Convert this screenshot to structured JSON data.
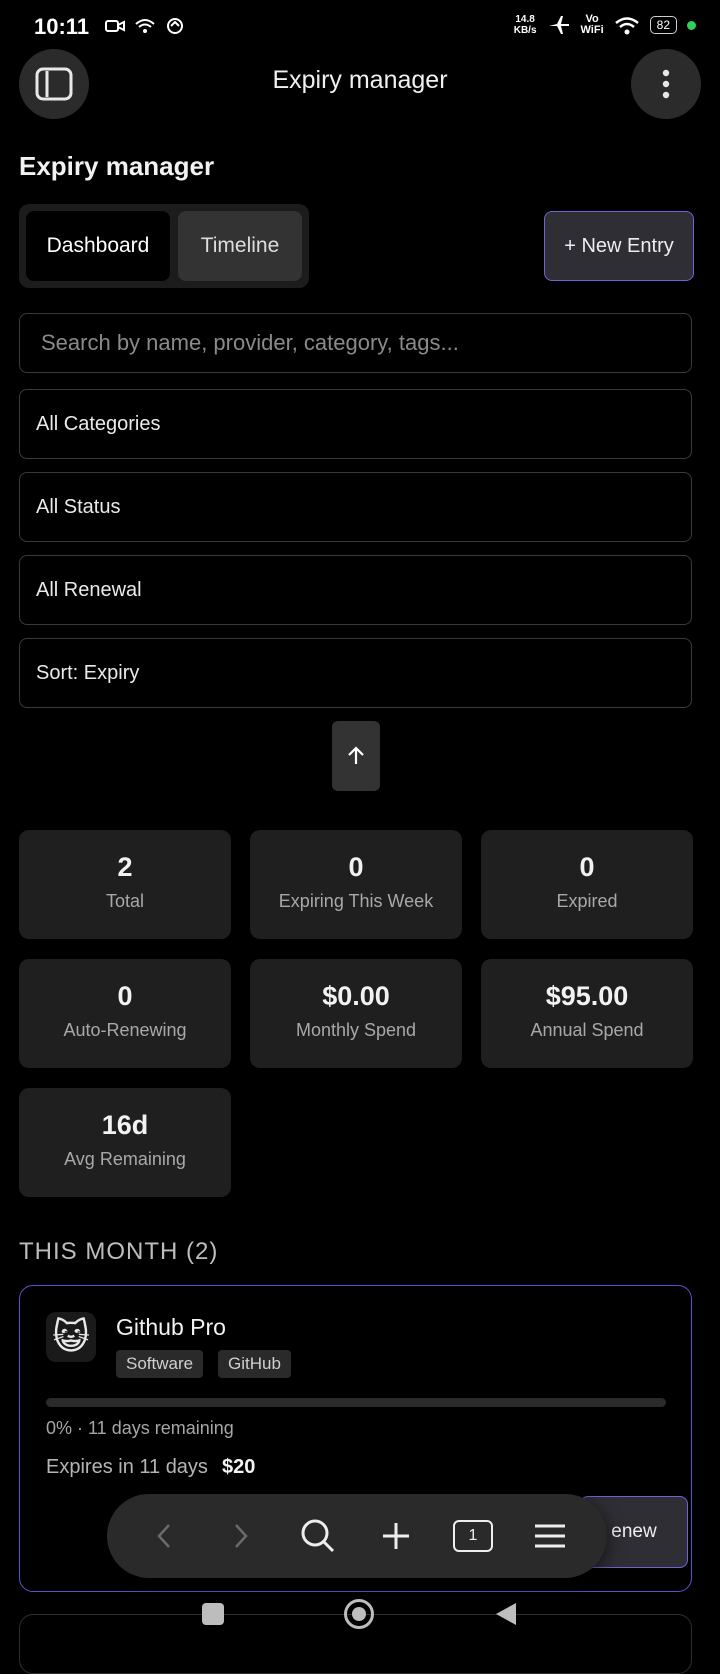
{
  "status_bar": {
    "time": "10:11",
    "net_speed_value": "14.8",
    "net_speed_unit": "KB/s",
    "vowifi_top": "Vo",
    "vowifi_bottom": "WiFi",
    "battery": "82",
    "icons": [
      "video-call-icon",
      "wifi-icon",
      "sync-icon",
      "airplane-icon",
      "wifi-signal-icon",
      "battery-icon"
    ]
  },
  "app_bar": {
    "title": "Expiry manager",
    "left_icon": "sidebar-icon",
    "right_icon": "more-vert-icon"
  },
  "page": {
    "title": "Expiry manager",
    "tabs": [
      {
        "label": "Dashboard",
        "active": true
      },
      {
        "label": "Timeline",
        "active": false
      }
    ],
    "new_entry_label": "+ New Entry"
  },
  "filters": {
    "search_placeholder": "Search by name, provider, category, tags...",
    "category": "All Categories",
    "status": "All Status",
    "renewal": "All Renewal",
    "sort": "Sort: Expiry",
    "sort_direction_icon": "arrow-up-icon"
  },
  "stats": [
    {
      "value": "2",
      "label": "Total"
    },
    {
      "value": "0",
      "label": "Expiring This Week"
    },
    {
      "value": "0",
      "label": "Expired"
    },
    {
      "value": "0",
      "label": "Auto-Renewing"
    },
    {
      "value": "$0.00",
      "label": "Monthly Spend"
    },
    {
      "value": "$95.00",
      "label": "Annual Spend"
    },
    {
      "value": "16d",
      "label": "Avg Remaining"
    }
  ],
  "section": {
    "heading": "THIS MONTH (2)"
  },
  "entries": [
    {
      "icon": "cat-emoji-icon",
      "emoji": "😺",
      "name": "Github Pro",
      "tags": [
        "Software",
        "GitHub"
      ],
      "progress_percent": 0,
      "progress_text": "0% · 11 days remaining",
      "expires_text": "Expires in 11 days",
      "price": "$20",
      "action_label_partial": "enew"
    }
  ],
  "browser_toolbar": {
    "items": [
      "back-icon",
      "forward-icon",
      "search-icon",
      "add-icon",
      "tabs-icon",
      "menu-icon"
    ],
    "tab_count": "1"
  },
  "colors": {
    "accent": "#6d63d8",
    "background": "#000000",
    "card": "#1f1f1f"
  }
}
